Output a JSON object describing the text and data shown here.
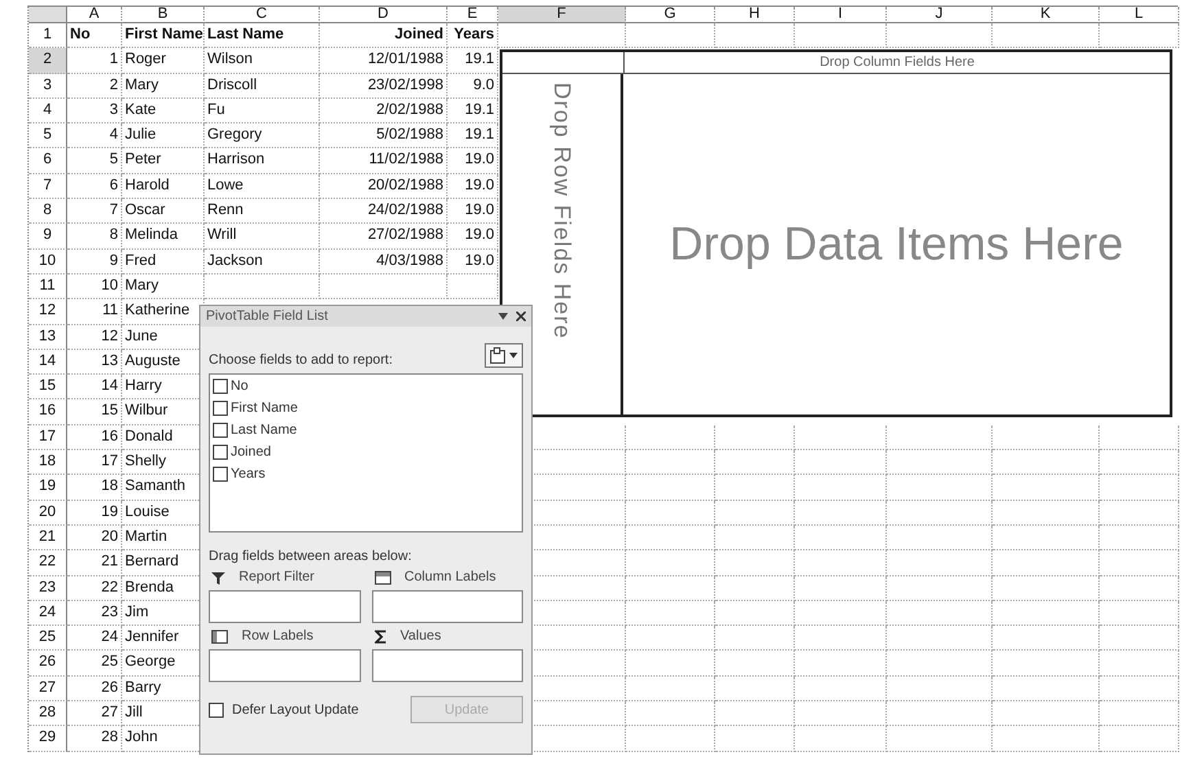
{
  "sheet": {
    "columns": [
      {
        "label": "A",
        "selected": false
      },
      {
        "label": "B",
        "selected": false
      },
      {
        "label": "C",
        "selected": false
      },
      {
        "label": "D",
        "selected": false
      },
      {
        "label": "E",
        "selected": false
      },
      {
        "label": "F",
        "selected": true
      },
      {
        "label": "G",
        "selected": false
      },
      {
        "label": "H",
        "selected": false
      },
      {
        "label": "I",
        "selected": false
      },
      {
        "label": "J",
        "selected": false
      },
      {
        "label": "K",
        "selected": false
      },
      {
        "label": "L",
        "selected": false
      }
    ],
    "rows": [
      {
        "header": "1",
        "selected": false,
        "kind": "heading",
        "cells": [
          "No",
          "First Name",
          "Last Name",
          "Joined",
          "Years"
        ]
      },
      {
        "header": "2",
        "selected": true,
        "kind": "data",
        "cells": [
          "1",
          "Roger",
          "Wilson",
          "12/01/1988",
          "19.1"
        ]
      },
      {
        "header": "3",
        "selected": false,
        "kind": "data",
        "cells": [
          "2",
          "Mary",
          "Driscoll",
          "23/02/1998",
          "9.0"
        ]
      },
      {
        "header": "4",
        "selected": false,
        "kind": "data",
        "cells": [
          "3",
          "Kate",
          "Fu",
          "2/02/1988",
          "19.1"
        ]
      },
      {
        "header": "5",
        "selected": false,
        "kind": "data",
        "cells": [
          "4",
          "Julie",
          "Gregory",
          "5/02/1988",
          "19.1"
        ]
      },
      {
        "header": "6",
        "selected": false,
        "kind": "data",
        "cells": [
          "5",
          "Peter",
          "Harrison",
          "11/02/1988",
          "19.0"
        ]
      },
      {
        "header": "7",
        "selected": false,
        "kind": "data",
        "cells": [
          "6",
          "Harold",
          "Lowe",
          "20/02/1988",
          "19.0"
        ]
      },
      {
        "header": "8",
        "selected": false,
        "kind": "data",
        "cells": [
          "7",
          "Oscar",
          "Renn",
          "24/02/1988",
          "19.0"
        ]
      },
      {
        "header": "9",
        "selected": false,
        "kind": "data",
        "cells": [
          "8",
          "Melinda",
          "Wrill",
          "27/02/1988",
          "19.0"
        ]
      },
      {
        "header": "10",
        "selected": false,
        "kind": "data",
        "cells": [
          "9",
          "Fred",
          "Jackson",
          "4/03/1988",
          "19.0"
        ]
      },
      {
        "header": "11",
        "selected": false,
        "kind": "data",
        "cells": [
          "10",
          "Mary"
        ]
      },
      {
        "header": "12",
        "selected": false,
        "kind": "data",
        "cells": [
          "11",
          "Katherine"
        ]
      },
      {
        "header": "13",
        "selected": false,
        "kind": "data",
        "cells": [
          "12",
          "June"
        ]
      },
      {
        "header": "14",
        "selected": false,
        "kind": "data",
        "cells": [
          "13",
          "Auguste"
        ]
      },
      {
        "header": "15",
        "selected": false,
        "kind": "data",
        "cells": [
          "14",
          "Harry"
        ]
      },
      {
        "header": "16",
        "selected": false,
        "kind": "data",
        "cells": [
          "15",
          "Wilbur"
        ]
      },
      {
        "header": "17",
        "selected": false,
        "kind": "data",
        "cells": [
          "16",
          "Donald"
        ]
      },
      {
        "header": "18",
        "selected": false,
        "kind": "data",
        "cells": [
          "17",
          "Shelly"
        ]
      },
      {
        "header": "19",
        "selected": false,
        "kind": "data",
        "cells": [
          "18",
          "Samanth"
        ]
      },
      {
        "header": "20",
        "selected": false,
        "kind": "data",
        "cells": [
          "19",
          "Louise"
        ]
      },
      {
        "header": "21",
        "selected": false,
        "kind": "data",
        "cells": [
          "20",
          "Martin"
        ]
      },
      {
        "header": "22",
        "selected": false,
        "kind": "data",
        "cells": [
          "21",
          "Bernard"
        ]
      },
      {
        "header": "23",
        "selected": false,
        "kind": "data",
        "cells": [
          "22",
          "Brenda"
        ]
      },
      {
        "header": "24",
        "selected": false,
        "kind": "data",
        "cells": [
          "23",
          "Jim"
        ]
      },
      {
        "header": "25",
        "selected": false,
        "kind": "data",
        "cells": [
          "24",
          "Jennifer"
        ]
      },
      {
        "header": "26",
        "selected": false,
        "kind": "data",
        "cells": [
          "25",
          "George"
        ]
      },
      {
        "header": "27",
        "selected": false,
        "kind": "data",
        "cells": [
          "26",
          "Barry"
        ]
      },
      {
        "header": "28",
        "selected": false,
        "kind": "data",
        "cells": [
          "27",
          "Jill"
        ]
      },
      {
        "header": "29",
        "selected": false,
        "kind": "data",
        "cells": [
          "28",
          "John"
        ]
      }
    ]
  },
  "pivot_area": {
    "column_drop": "Drop Column Fields Here",
    "row_drop": "Drop Row Fields Here",
    "data_drop": "Drop Data Items Here"
  },
  "field_list": {
    "title": "PivotTable Field List",
    "choose_label": "Choose fields to add to report:",
    "fields": [
      {
        "label": "No",
        "checked": false
      },
      {
        "label": "First Name",
        "checked": false
      },
      {
        "label": "Last Name",
        "checked": false
      },
      {
        "label": "Joined",
        "checked": false
      },
      {
        "label": "Years",
        "checked": false
      }
    ],
    "drag_label": "Drag fields between areas below:",
    "areas": [
      {
        "kind": "filter",
        "label": "Report Filter"
      },
      {
        "kind": "columns",
        "label": "Column Labels"
      },
      {
        "kind": "rows",
        "label": "Row Labels"
      },
      {
        "kind": "values",
        "label": "Values"
      }
    ],
    "defer": {
      "label": "Defer Layout Update",
      "checked": false
    },
    "update_button": {
      "label": "Update",
      "disabled": true
    }
  }
}
